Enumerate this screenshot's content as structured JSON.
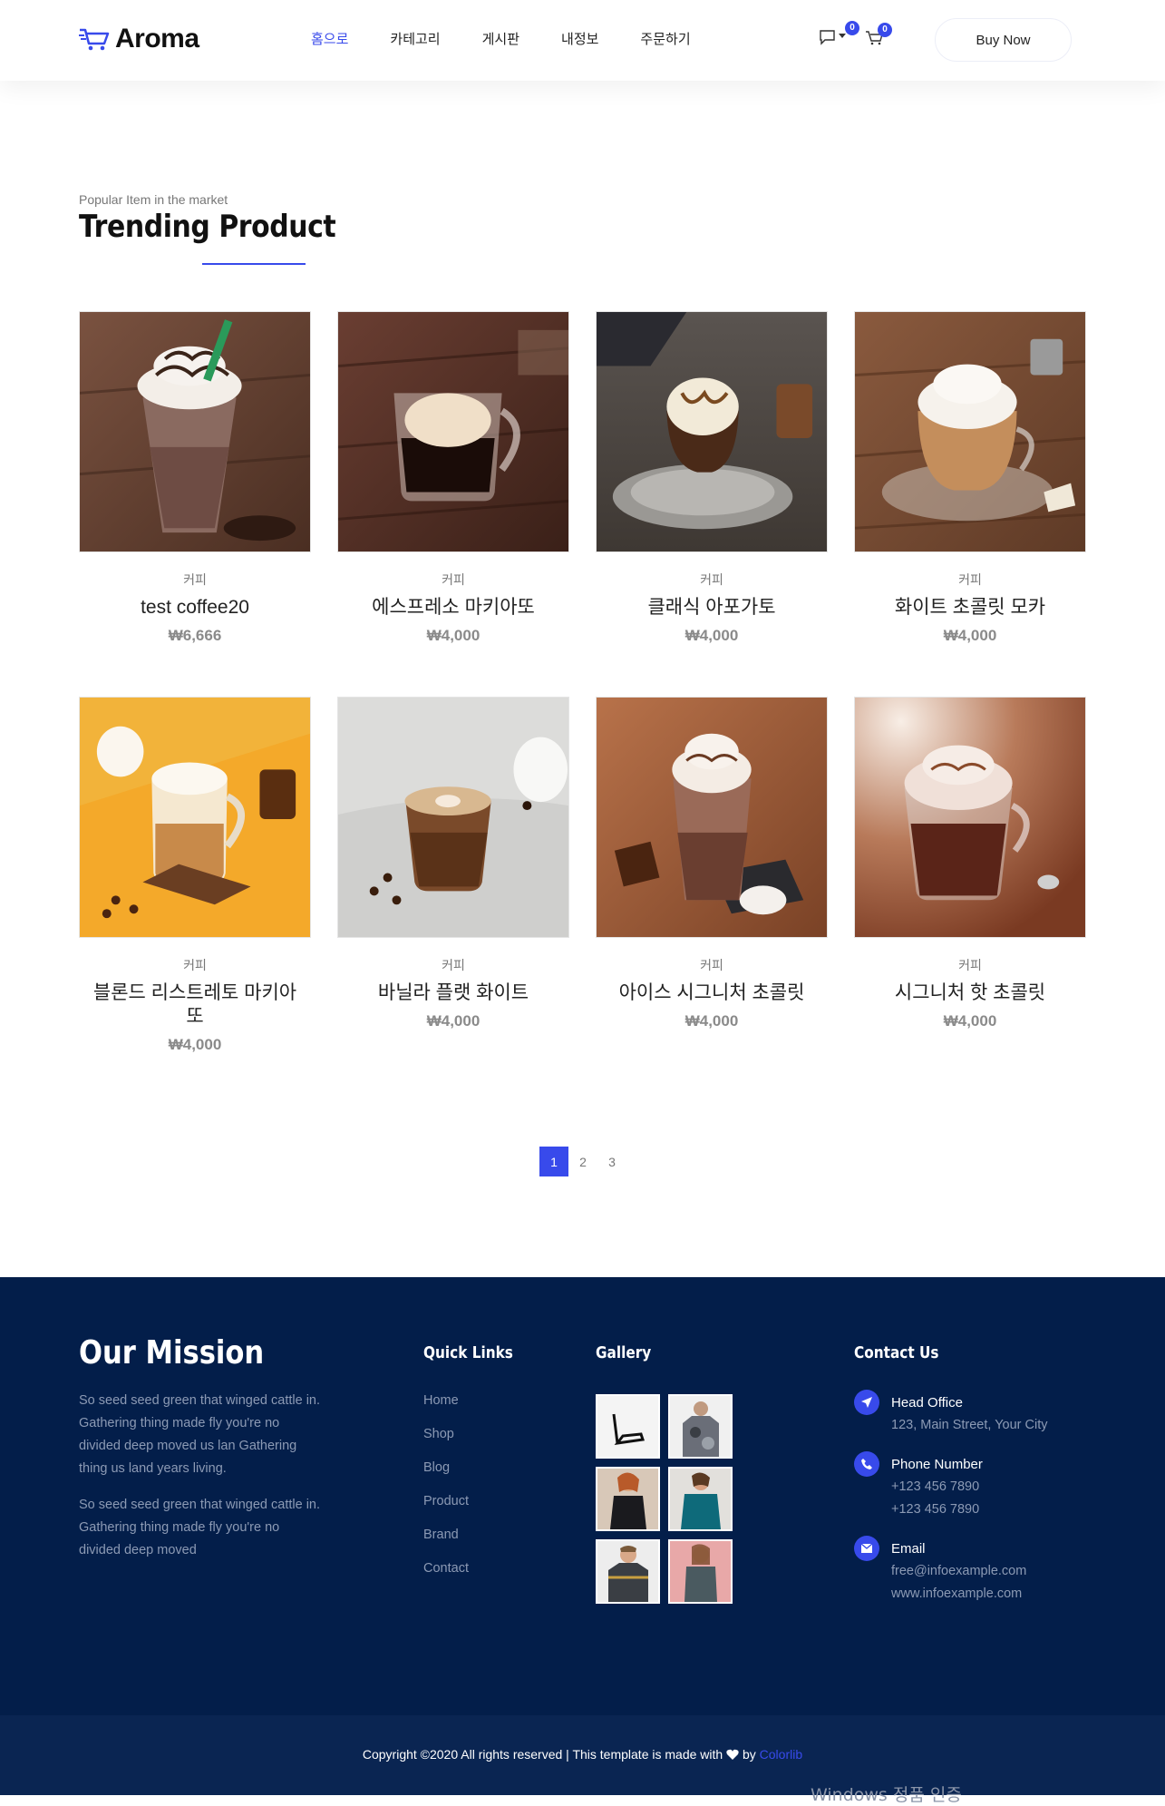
{
  "header": {
    "brand": "Aroma",
    "nav": [
      {
        "label": "홈으로",
        "active": true
      },
      {
        "label": "카테고리",
        "active": false
      },
      {
        "label": "게시판",
        "active": false
      },
      {
        "label": "내정보",
        "active": false
      },
      {
        "label": "주문하기",
        "active": false
      }
    ],
    "message_count": "0",
    "cart_count": "0",
    "buy_now": "Buy Now",
    "accent_color": "#384aeb"
  },
  "section": {
    "subtitle": "Popular Item in the market",
    "title": "Trending Product"
  },
  "products": [
    {
      "category": "커피",
      "name": "test coffee20",
      "price": "₩6,666",
      "image": "frappuccino-whipped-chocolate"
    },
    {
      "category": "커피",
      "name": "에스프레소 마키아또",
      "price": "₩4,000",
      "image": "espresso-glass"
    },
    {
      "category": "커피",
      "name": "클래식 아포가토",
      "price": "₩4,000",
      "image": "affogato"
    },
    {
      "category": "커피",
      "name": "화이트 초콜릿 모카",
      "price": "₩4,000",
      "image": "white-chocolate-mocha"
    },
    {
      "category": "커피",
      "name": "블론드 리스트레토 마키아또",
      "price": "₩4,000",
      "image": "layered-macchiato-yellow"
    },
    {
      "category": "커피",
      "name": "바닐라 플랫 화이트",
      "price": "₩4,000",
      "image": "flat-white-latte-art"
    },
    {
      "category": "커피",
      "name": "아이스 시그니처 초콜릿",
      "price": "₩4,000",
      "image": "iced-chocolate"
    },
    {
      "category": "커피",
      "name": "시그니처 핫 초콜릿",
      "price": "₩4,000",
      "image": "hot-chocolate"
    }
  ],
  "pagination": {
    "pages": [
      "1",
      "2",
      "3"
    ],
    "current": "1"
  },
  "footer": {
    "mission": {
      "title": "Our Mission",
      "p1": "So seed seed green that winged cattle in. Gathering thing made fly you're no divided deep moved us lan Gathering thing us land years living.",
      "p2": "So seed seed green that winged cattle in. Gathering thing made fly you're no divided deep moved"
    },
    "quick_links": {
      "title": "Quick Links",
      "items": [
        "Home",
        "Shop",
        "Blog",
        "Product",
        "Brand",
        "Contact"
      ]
    },
    "gallery": {
      "title": "Gallery",
      "images": [
        "heels-shoe",
        "camo-tshirt-man",
        "black-dress-woman",
        "teal-dress-woman",
        "football-jersey-man",
        "pink-top-woman"
      ]
    },
    "contact": {
      "title": "Contact Us",
      "head_office_label": "Head Office",
      "head_office_value": "123, Main Street, Your City",
      "phone_label": "Phone Number",
      "phone_1": "+123 456 7890",
      "phone_2": "+123 456 7890",
      "email_label": "Email",
      "email_1": "free@infoexample.com",
      "email_2": "www.infoexample.com"
    },
    "copyright_pre": "Copyright ©2020 All rights reserved | This template is made with",
    "copyright_by": "by",
    "copyright_brand": "Colorlib"
  },
  "watermark": "Windows 정품 인증"
}
